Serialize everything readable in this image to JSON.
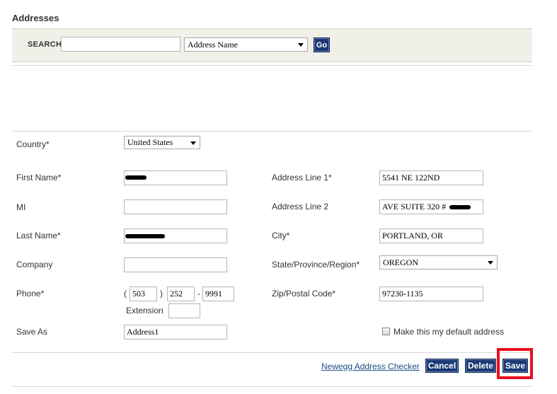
{
  "page": {
    "title": "Addresses"
  },
  "search": {
    "label": "SEARCH",
    "value": "",
    "select_value": "Address Name",
    "go_label": "Go"
  },
  "form": {
    "country": {
      "label": "Country*",
      "value": "United States"
    },
    "first_name": {
      "label": "First Name*",
      "value": ""
    },
    "mi": {
      "label": "MI",
      "value": ""
    },
    "last_name": {
      "label": "Last Name*",
      "value": ""
    },
    "company": {
      "label": "Company",
      "value": ""
    },
    "phone": {
      "label": "Phone*",
      "area": "503",
      "prefix": "252",
      "line": "9991",
      "open_paren": "(",
      "close_paren": ")",
      "dash": "-"
    },
    "extension": {
      "label": "Extension",
      "value": ""
    },
    "save_as": {
      "label": "Save As",
      "value": "Address1"
    },
    "address1": {
      "label": "Address Line 1*",
      "value": "5541 NE 122ND"
    },
    "address2": {
      "label": "Address Line 2",
      "value": "AVE SUITE 320 #"
    },
    "city": {
      "label": "City*",
      "value": "PORTLAND, OR"
    },
    "state": {
      "label": "State/Province/Region*",
      "value": "OREGON"
    },
    "zip": {
      "label": "Zip/Postal Code*",
      "value": "97230-1135"
    },
    "default_checkbox": {
      "label": "Make this my default address",
      "checked": false
    }
  },
  "actions": {
    "checker_link": "Newegg Address Checker",
    "cancel": "Cancel",
    "delete": "Delete",
    "save": "Save",
    "highlight_color": "#e8101e"
  }
}
